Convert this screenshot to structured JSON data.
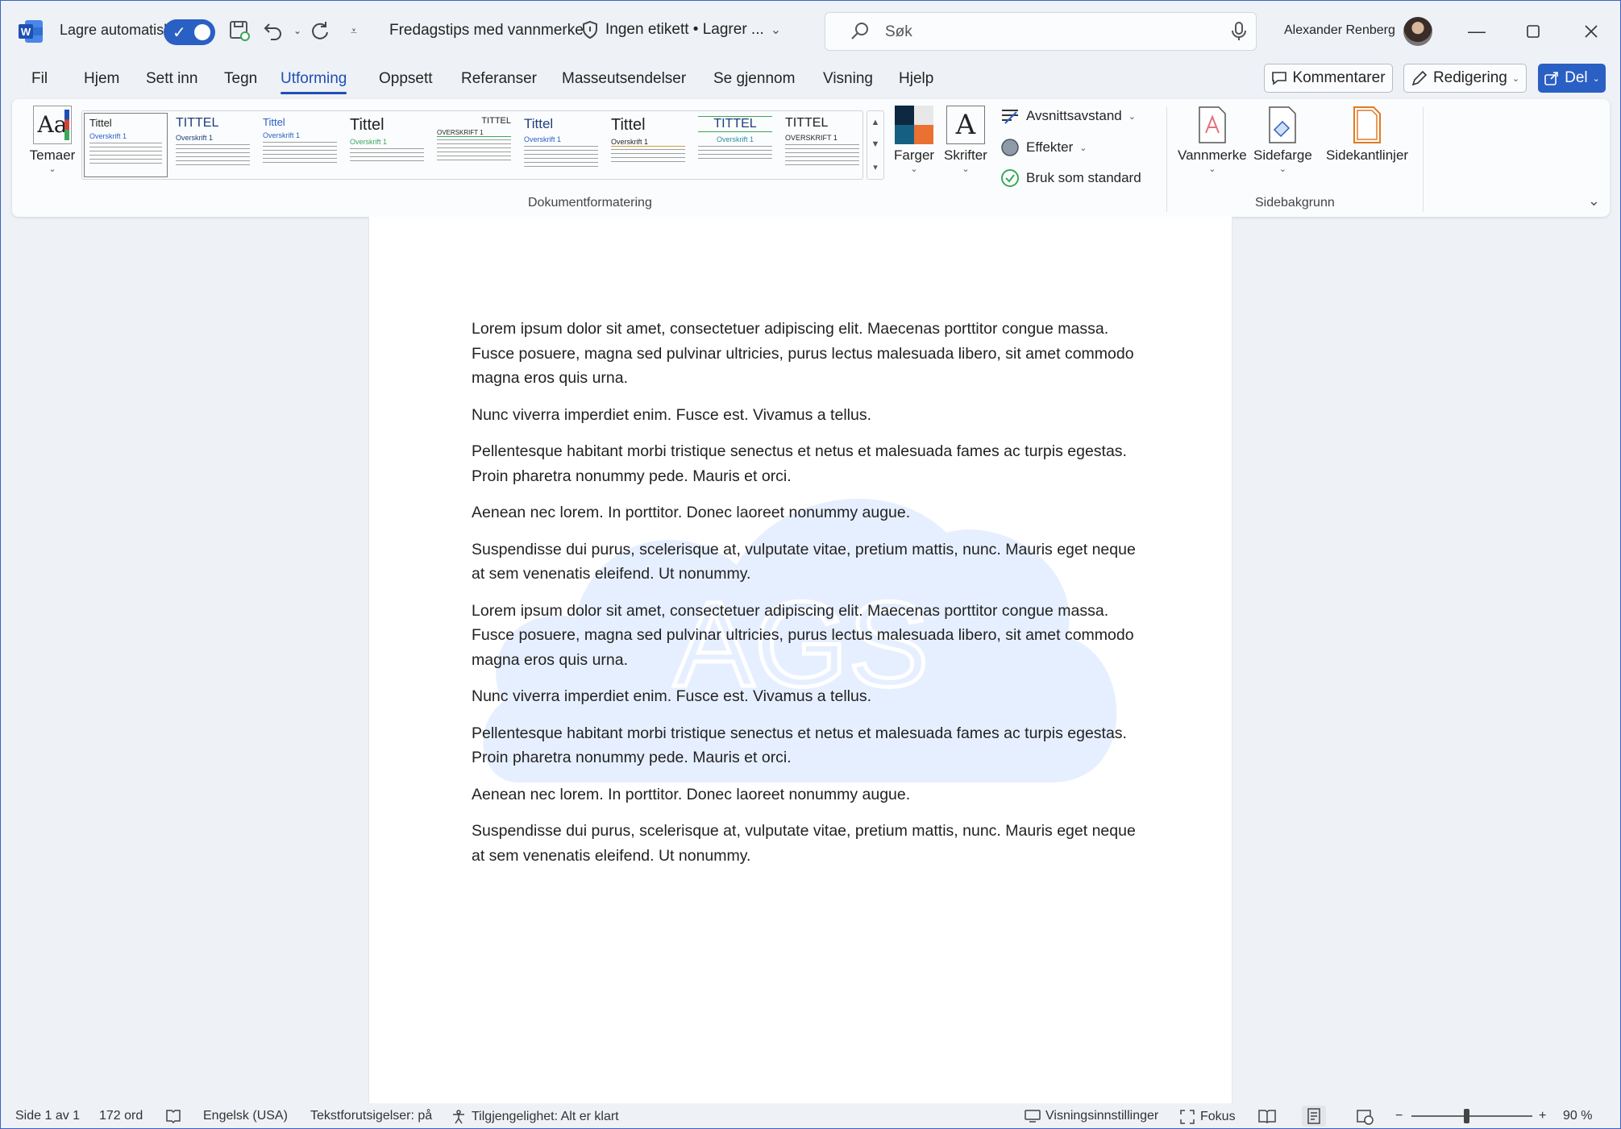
{
  "titlebar": {
    "autosave_label": "Lagre automatisk",
    "document_title": "Fredagstips med vannmerke",
    "label_info": "Ingen etikett • Lagrer ...",
    "search_placeholder": "Søk",
    "user_name": "Alexander Renberg"
  },
  "menu": {
    "tabs": [
      "Fil",
      "Hjem",
      "Sett inn",
      "Tegn",
      "Utforming",
      "Oppsett",
      "Referanser",
      "Masseutsendelser",
      "Se gjennom",
      "Visning",
      "Hjelp"
    ],
    "active_tab": "Utforming",
    "comments_label": "Kommentarer",
    "editing_label": "Redigering",
    "share_label": "Del"
  },
  "ribbon": {
    "themes_label": "Temaer",
    "style_gallery": [
      {
        "title": "Tittel",
        "heading": "Overskrift 1"
      },
      {
        "title": "TITTEL",
        "heading": "Overskrift 1"
      },
      {
        "title": "Tittel",
        "heading": "Overskrift 1"
      },
      {
        "title": "Tittel",
        "heading": "Overskrift 1"
      },
      {
        "title": "TITTEL",
        "heading": "OVERSKRIFT 1"
      },
      {
        "title": "Tittel",
        "heading": "Overskrift 1"
      },
      {
        "title": "Tittel",
        "heading": "Overskrift 1"
      },
      {
        "title": "TITTEL",
        "heading": "Overskrift 1"
      },
      {
        "title": "TITTEL",
        "heading": "OVERSKRIFT 1"
      }
    ],
    "colors_label": "Farger",
    "fonts_label": "Skrifter",
    "paragraph_spacing_label": "Avsnittsavstand",
    "effects_label": "Effekter",
    "set_default_label": "Bruk som standard",
    "group_document_formatting": "Dokumentformatering",
    "watermark_label": "Vannmerke",
    "page_color_label": "Sidefarge",
    "page_borders_label": "Sidekantlinjer",
    "group_page_background": "Sidebakgrunn"
  },
  "document": {
    "watermark_text": "AGS",
    "paragraphs": [
      "Lorem ipsum dolor sit amet, consectetuer adipiscing elit. Maecenas porttitor congue massa. Fusce posuere, magna sed pulvinar ultricies, purus lectus malesuada libero, sit amet commodo magna eros quis urna.",
      "Nunc viverra imperdiet enim. Fusce est. Vivamus a tellus.",
      "Pellentesque habitant morbi tristique senectus et netus et malesuada fames ac turpis egestas. Proin pharetra nonummy pede. Mauris et orci.",
      "Aenean nec lorem. In porttitor. Donec laoreet nonummy augue.",
      "Suspendisse dui purus, scelerisque at, vulputate vitae, pretium mattis, nunc. Mauris eget neque at sem venenatis eleifend. Ut nonummy.",
      "Lorem ipsum dolor sit amet, consectetuer adipiscing elit. Maecenas porttitor congue massa. Fusce posuere, magna sed pulvinar ultricies, purus lectus malesuada libero, sit amet commodo magna eros quis urna.",
      "Nunc viverra imperdiet enim. Fusce est. Vivamus a tellus.",
      "Pellentesque habitant morbi tristique senectus et netus et malesuada fames ac turpis egestas. Proin pharetra nonummy pede. Mauris et orci.",
      "Aenean nec lorem. In porttitor. Donec laoreet nonummy augue.",
      "Suspendisse dui purus, scelerisque at, vulputate vitae, pretium mattis, nunc. Mauris eget neque at sem venenatis eleifend. Ut nonummy."
    ]
  },
  "statusbar": {
    "page": "Side 1 av 1",
    "words": "172 ord",
    "language": "Engelsk (USA)",
    "text_predictions": "Tekstforutsigelser: på",
    "accessibility": "Tilgjengelighet: Alt er klart",
    "display_settings": "Visningsinnstillinger",
    "focus": "Fokus",
    "zoom_label": "90 %",
    "zoom_percent": 90
  },
  "colors": {
    "accent": "#2a5fc4",
    "watermark_fill": "#e6efff"
  }
}
